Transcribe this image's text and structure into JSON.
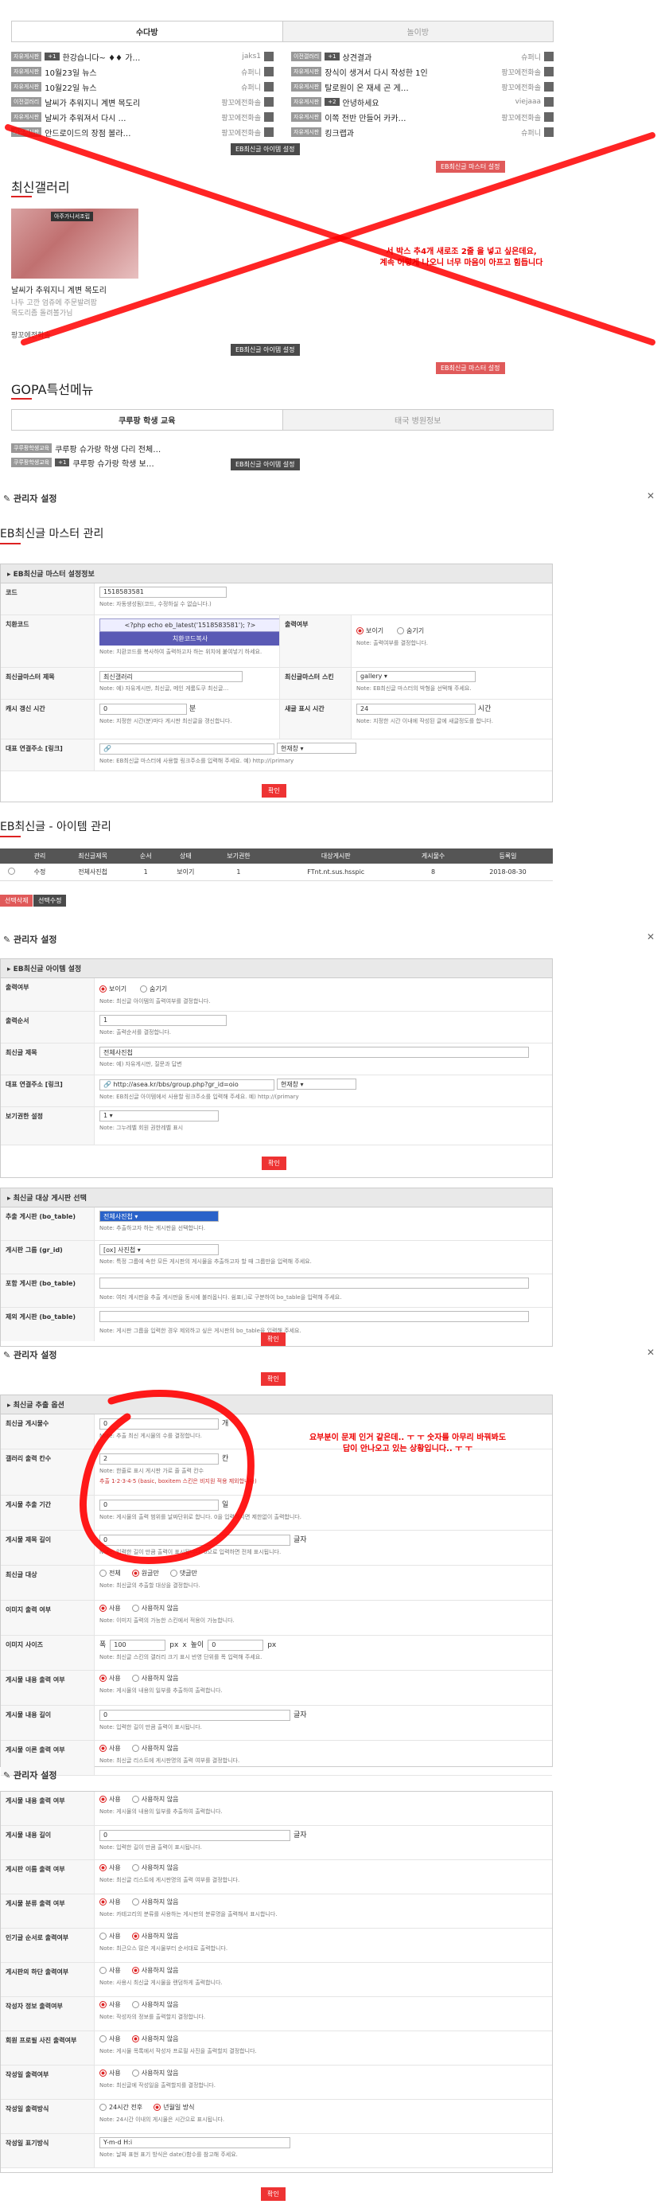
{
  "top": {
    "tabs": [
      "수다방",
      "놀이방"
    ],
    "rows_left": [
      {
        "badge": "자유게시판",
        "num": "+1",
        "title": "한강습니다~ ♦♦ 가…",
        "nick": "jaks1"
      },
      {
        "badge": "자유게시판",
        "num": "",
        "title": "10월23일 뉴스",
        "nick": "슈퍼니"
      },
      {
        "badge": "자유게시판",
        "num": "",
        "title": "10월22일 뉴스",
        "nick": "슈퍼니"
      },
      {
        "badge": "이전갤러리",
        "num": "",
        "title": "날씨가 추워지니 계변 목도리",
        "nick": "팡꼬에전화솔"
      },
      {
        "badge": "자유게시판",
        "num": "",
        "title": "날씨가 추워져서 다시 …",
        "nick": "팡꼬에전화솔"
      },
      {
        "badge": "자유게시판",
        "num": "",
        "title": "안드로이드의 장점 볼라…",
        "nick": "팡꼬에전화솔"
      }
    ],
    "rows_right": [
      {
        "badge": "이전갤러리",
        "num": "+1",
        "title": "상견결과",
        "nick": "슈퍼니"
      },
      {
        "badge": "자유게시판",
        "num": "",
        "title": "장식이 생겨서 다시 작성한 1인",
        "nick": "팡꼬에전화솔"
      },
      {
        "badge": "자유게시판",
        "num": "",
        "title": "탈로원이 온 재세 곤 게…",
        "nick": "팡꼬에전화솔"
      },
      {
        "badge": "자유게시판",
        "num": "+2",
        "title": "안녕하세요",
        "nick": "viejaaa"
      },
      {
        "badge": "자유게시판",
        "num": "",
        "title": "이쪽 전반 만들어 카카…",
        "nick": "팡꼬에전화솔"
      },
      {
        "badge": "자유게시판",
        "num": "",
        "title": "킹크랩과",
        "nick": "슈퍼니"
      }
    ],
    "item_btn": "EB최신글 아이템 설정",
    "master_btn": "EB최신글 마스터 설정"
  },
  "gallery": {
    "title": "최신갤러리",
    "thumb_label": "아주가니서조립",
    "caption": "날씨가 추워지니 계변 목도리",
    "desc1": "나두 고깐 엄쥬에 주문발려팜",
    "desc2": "목도리좀 돌려볼가님",
    "author": "팡꼬에전화솔",
    "item_btn": "EB최신글 아이템 설정",
    "master_btn": "EB최신글 마스터 설정"
  },
  "annotation1": "서 박스 추4개 새로조 2줄 을 넣고 싶은데요,\n계속 이렇게 나오니 너무 마음이 아프고 힘듭니다",
  "gopa": {
    "title": "GOPA특선메뉴",
    "tabs": [
      "쿠루팡 학생 교육",
      "태국 병원정보"
    ],
    "rows": [
      {
        "badge": "쿠루팡학생교육",
        "num": "",
        "title": "쿠루팡 슈가랑 학생 다리 전체…"
      },
      {
        "badge": "쿠루팡학생교육",
        "num": "+1",
        "title": "쿠루팡 슈가랑 학생 보…"
      }
    ],
    "item_btn": "EB최신글 아이템 설정"
  },
  "admin1": {
    "heading": "관리자 설정",
    "title": "EB최신글 마스터 관리",
    "box_head": "EB최신글 마스터 설정정보",
    "code_label": "코드",
    "code_value": "1518583581",
    "code_note": "Note: 자동생성됨(코드, 수정하실 수 없습니다.)",
    "insert_label": "치환코드",
    "insert_value": "<?php echo eb_latest('1518583581'); ?>",
    "insert_btn": "치환코드복사",
    "insert_note": "Note: 치환코드를 복사하여 출력하고자 하는 위치에 붙여넣기 하세요.",
    "show_label": "출력여부",
    "show_opt1": "보이기",
    "show_opt2": "숨기기",
    "show_note": "Note: 출력여부를 결정합니다.",
    "mtitle_label": "최신글마스터 제목",
    "mtitle_value": "최신갤러리",
    "mtitle_note": "Note: 예) 자유게시판, 최신글, 메인 게룸도쿠 최신글…",
    "skin_label": "최신글마스터 스킨",
    "skin_value": "gallery",
    "skin_note": "Note: EB최신글 마스터의 박형을 선택해 주세요.",
    "cache_label": "캐시 갱신 시간",
    "cache_value": "0",
    "cache_unit": "분",
    "cache_note": "Note: 지정한 시간(분)마다 게시판 최신글을 갱신합니다.",
    "new_label": "새글 표시 시간",
    "new_value": "24",
    "new_unit": "시간",
    "new_note": "Note: 지정한 시간 이내에 작성된 글에 새글정도를 합니다.",
    "link_label": "대표 연결주소 [링크]",
    "link_target": "현재창",
    "link_note": "Note: EB최신글 마스터에 사용할 링크주소를 입력해 주세요. 예) http://(primary",
    "submit": "확인"
  },
  "items": {
    "title": "EB최신글 - 아이템 관리",
    "headers": [
      "",
      "관리",
      "최신글제목",
      "순서",
      "상태",
      "보기권한",
      "대상게시판",
      "게시물수",
      "등록일"
    ],
    "row": [
      "",
      "수정",
      "전체사진첩",
      "1",
      "보이기",
      "1",
      "FTnt.nt.sus.hsspic",
      "8",
      "2018-08-30"
    ],
    "btn_del": "선택삭제",
    "btn_edit": "선택수정"
  },
  "admin2": {
    "heading": "관리자 설정",
    "box_head": "EB최신글 아이템 설정",
    "show_label": "출력여부",
    "show_opt1": "보이기",
    "show_opt2": "숨기기",
    "show_note": "Note: 최신글 아이템의 출력여부를 결정합니다.",
    "order_label": "출력순서",
    "order_value": "1",
    "order_note": "Note: 출력순서를 결정합니다.",
    "title_label": "최신글 제목",
    "title_value": "전체사진첩",
    "title_note": "Note: 예) 자유게시판, 질문과 답변",
    "link_label": "대표 연결주소 [링크]",
    "link_value": "http://asea.kr/bbs/group.php?gr_id=oio",
    "link_target": "현재창",
    "link_note": "Note: EB최신글 아이템에서 사용할 링크주소를 입력해 주세요. 예) http://(primary",
    "perm_label": "보기권한 설정",
    "perm_value": "1",
    "perm_note": "Note: 그누레벨 회원 권한레벨 표시",
    "submit": "확인",
    "box2_head": "최신글 대상 게시판 선택",
    "bo_label": "추출 게시판 (bo_table)",
    "bo_value": "전체사진첩",
    "bo_note": "Note: 추출하고자 하는 게시판을 선택합니다.",
    "gr_label": "게시판 그룹 (gr_id)",
    "gr_value": "[ox] 사진첩",
    "gr_note": "Note: 특정 그룹에 속한 모든 게시판의 게시물을 추출하고자 할 때 그룹만을 입력해 주세요.",
    "inc_label": "포함 게시판 (bo_table)",
    "inc_note": "Note: 여러 게시판을 추출 게시판을 동시에 불러옵니다. 쉼표(,)로 구분하여 bo_table을 입력해 주세요.",
    "exc_label": "제외 게시판 (bo_table)",
    "exc_note": "Note: 게시판 그룹을 입력한 경우 제외하고 싶은 게시판의 bo_table을 입력해 주세요.",
    "submit2": "확인"
  },
  "admin3": {
    "heading": "관리자 설정",
    "submit_top": "확인",
    "box_head": "최신글 추출 옵션",
    "cnt_label": "최신글 게시물수",
    "cnt_value": "0",
    "cnt_unit": "개",
    "cnt_note": "Note: 추출 최신 게시물의 수를 결정합니다.",
    "col_label": "갤러리 출력 칸수",
    "col_value": "2",
    "col_unit": "칸",
    "col_note": "Note: 한줄로 표시 게시판 가로 줄 출력 칸수",
    "col_note2": "추출  1·2·3·4·5 (basic, boxitem 스킨은 비지원 적용 제외합니다)",
    "period_label": "게시물 추출 기간",
    "period_value": "0",
    "period_unit": "일",
    "period_note": "Note: 게시물의 출력 범위를 날짜단위로 합니다. 0을 입력하시면 제한없이 출력합니다.",
    "tlen_label": "게시물 제목 길이",
    "tlen_value": "0",
    "tlen_unit": "글자",
    "tlen_note": "Note: 입력한 길이 만큼 출력이 표시됩니다. 0으로 입력하면 전체 표시됩니다.",
    "target_label": "최신글 대상",
    "target_opts": [
      "전체",
      "원글만",
      "댓글만"
    ],
    "target_note": "Note: 최신글의 추출할 대상을 결정합니다.",
    "img_label": "이미지 출력 여부",
    "img_opts": [
      "사용",
      "사용하지 않음"
    ],
    "img_note": "Note: 이미지 출력의 가능한 스킨에서 적용이 가능합니다.",
    "size_label": "이미지 사이즈",
    "size_w_pre": "폭",
    "size_w": "100",
    "size_w_unit": "px",
    "size_x": "x",
    "size_h_pre": "높이",
    "size_h": "0",
    "size_h_unit": "px",
    "size_note": "Note: 최신글 스킨의 갤러리 크기 표시 반영 단위를 폭 입력해 주세요.",
    "body_label": "게시물 내용 출력 여부",
    "body_opts": [
      "사용",
      "사용하지 않음"
    ],
    "body_note": "Note: 게시물의 내용의 일부를 추출하여 출력합니다.",
    "blen_label": "게시물 내용 길이",
    "blen_value": "0",
    "blen_unit": "글자",
    "blen_note": "Note: 입력한 길이 만큼 출력이 표시됩니다.",
    "file_label": "게시물 이른 출력 여부",
    "file_opts": [
      "사용",
      "사용하지 않음"
    ],
    "file_note": "Note: 최신글 리스트에 게시판명의 출력 여부를 결정합니다."
  },
  "annotation2": "요부분이 문제 인거 같은데.. ㅜ ㅜ 숫자를 아무리 바꿔봐도\n답이 안나오고 있는 상황입니다.. ㅜ ㅜ",
  "admin4": {
    "heading": "관리자 설정",
    "rows": [
      {
        "label": "게시물 내용 출력 여부",
        "type": "radio",
        "opts": [
          "사용",
          "사용하지 않음"
        ],
        "on": 0,
        "note": "Note: 게시물의 내용의 일부를 추출하여 출력합니다."
      },
      {
        "label": "게시물 내용 길이",
        "type": "input",
        "value": "0",
        "unit": "글자",
        "note": "Note: 입력한 길이 만큼 출력이 표시됩니다."
      },
      {
        "label": "게시판 이름 출력 여부",
        "type": "radio",
        "opts": [
          "사용",
          "사용하지 않음"
        ],
        "on": 0,
        "note": "Note: 최신글 리스트에 게시판명의 출력 여부를 결정합니다."
      },
      {
        "label": "게시물 분류 출력 여부",
        "type": "radio",
        "opts": [
          "사용",
          "사용하지 않음"
        ],
        "on": 0,
        "note": "Note: 카테고리의 분류를 사용하는 게시판의 분류명을 출력해서 표시합니다."
      },
      {
        "label": "인기글 순서로 출력여부",
        "type": "radio",
        "opts": [
          "사용",
          "사용하지 않음"
        ],
        "on": 1,
        "note": "Note: 최근으스 많은 게시물부터 순서대로 출력합니다."
      },
      {
        "label": "게시판의 하단 출력여부",
        "type": "radio",
        "opts": [
          "사용",
          "사용하지 않음"
        ],
        "on": 1,
        "note": "Note: 사용시 최신글 게시물을 랜덤하게 출력합니다."
      },
      {
        "label": "작성자 정보 출력여부",
        "type": "radio",
        "opts": [
          "사용",
          "사용하지 않음"
        ],
        "on": 0,
        "note": "Note: 작성자의 정보를 출력할지 결정합니다."
      },
      {
        "label": "회원 프로필 사진 출력여부",
        "type": "radio",
        "opts": [
          "사용",
          "사용하지 않음"
        ],
        "on": 1,
        "note": "Note: 게시물 목록에서 작성자 프로필 사진을 출력할지 결정합니다."
      },
      {
        "label": "작성일 출력여부",
        "type": "radio",
        "opts": [
          "사용",
          "사용하지 않음"
        ],
        "on": 0,
        "note": "Note: 최신글에 작성일을 출력할지를 결정합니다."
      },
      {
        "label": "작성일 출력방식",
        "type": "radio",
        "opts": [
          "24시간 전후",
          "년월일 방식"
        ],
        "on": 1,
        "note": "Note: 24시간 이내의 게시물은 시간으로 표시됩니다."
      },
      {
        "label": "작성일 표기방식",
        "type": "input",
        "value": "Y-m-d H:i",
        "unit": "",
        "note": "Note: 날짜 표현 표기 방식은 date()함수를 참고해 주세요."
      }
    ],
    "submit": "확인"
  },
  "colors": {
    "accent": "#e33333",
    "annot": "#ff0000"
  }
}
